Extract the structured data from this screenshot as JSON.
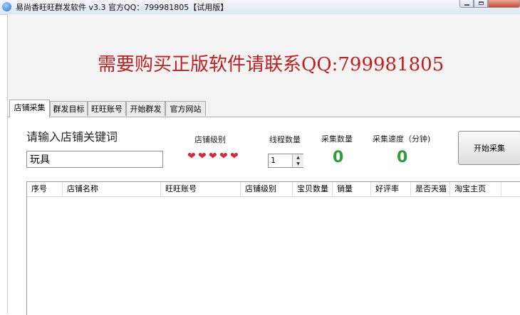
{
  "window": {
    "title": "易尚香旺旺群发软件 v3.3 官方QQ：799981805【试用版】"
  },
  "banner": {
    "text": "需要购买正版软件请联系QQ:799981805"
  },
  "tabs": [
    {
      "label": "店铺采集",
      "active": true
    },
    {
      "label": "群发目标",
      "active": false
    },
    {
      "label": "旺旺账号",
      "active": false
    },
    {
      "label": "开始群发",
      "active": false
    },
    {
      "label": "官方网站",
      "active": false
    }
  ],
  "collect": {
    "keyword_label": "请输入店铺关键词",
    "keyword_value": "玩具",
    "level_label": "店铺级别",
    "level_hearts": 5,
    "threads_label": "线程数量",
    "threads_value": "1",
    "count_label": "采集数量",
    "count_value": "0",
    "speed_label": "采集速度（分钟)",
    "speed_value": "0",
    "start_button": "开始采集"
  },
  "table": {
    "columns": [
      "序号",
      "店铺名称",
      "旺旺账号",
      "店铺级别",
      "宝贝数量",
      "销量",
      "好评率",
      "是否天猫",
      "淘宝主页"
    ],
    "rows": []
  },
  "colors": {
    "banner_text": "#c11f1f",
    "counter": "#2e9e3d",
    "hearts": "#d8283c"
  }
}
